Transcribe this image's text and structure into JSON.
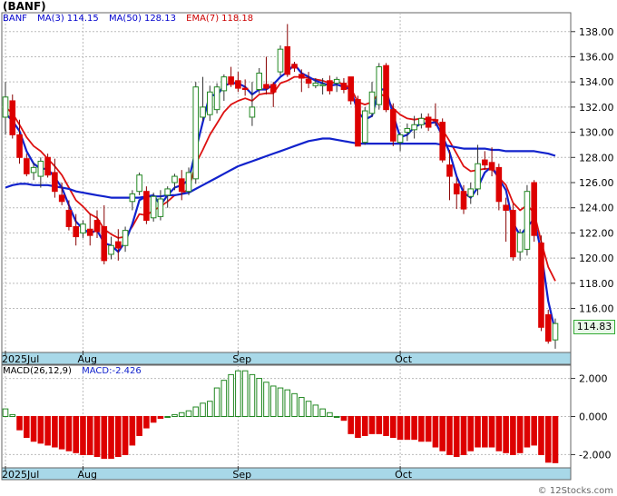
{
  "header": {
    "title": "(BANF)",
    "legend": {
      "symbol": "BANF",
      "ma3": "MA(3)",
      "ma3_value": "114.15",
      "ma50": "MA(50)",
      "ma50_value": "128.13",
      "ema7": "EMA(7)",
      "ema7_value": "118.18"
    }
  },
  "macd_panel": {
    "label": "MACD(26,12,9)",
    "value_label": "MACD:-2.426"
  },
  "last_price_label": "114.83",
  "watermark": "© 12Stocks.com",
  "colors": {
    "up": "#228822",
    "down": "#dd0000",
    "ma3": "#1122cc",
    "ma50": "#1122cc",
    "ema7": "#dd1111",
    "axis_band": "#a8d8e8"
  },
  "chart_data": [
    {
      "type": "candlestick",
      "x_tick_labels": [
        "2025Jul",
        "Aug",
        "Sep",
        "Oct"
      ],
      "y_tick_labels": [
        "116.00",
        "118.00",
        "120.00",
        "122.00",
        "124.00",
        "126.00",
        "128.00",
        "130.00",
        "132.00",
        "134.00",
        "136.00",
        "138.00"
      ],
      "ylim": [
        112.5,
        139.5
      ],
      "last_price": 114.83,
      "ohlc": [
        {
          "o": 131.2,
          "h": 134,
          "l": 129.8,
          "c": 132.8
        },
        {
          "o": 132.5,
          "h": 133,
          "l": 129.5,
          "c": 129.8
        },
        {
          "o": 129.8,
          "h": 131,
          "l": 127.5,
          "c": 128
        },
        {
          "o": 127.9,
          "h": 128.3,
          "l": 126.5,
          "c": 126.7
        },
        {
          "o": 126.8,
          "h": 127.6,
          "l": 126.2,
          "c": 127.2
        },
        {
          "o": 126.5,
          "h": 128,
          "l": 125.6,
          "c": 127.7
        },
        {
          "o": 128,
          "h": 128.3,
          "l": 126.4,
          "c": 126.6
        },
        {
          "o": 126.8,
          "h": 127.9,
          "l": 124.8,
          "c": 125.3
        },
        {
          "o": 125,
          "h": 126,
          "l": 124.2,
          "c": 124.5
        },
        {
          "o": 123.8,
          "h": 124.6,
          "l": 122.2,
          "c": 122.5
        },
        {
          "o": 122.5,
          "h": 123.5,
          "l": 121,
          "c": 121.7
        },
        {
          "o": 122,
          "h": 123,
          "l": 121.6,
          "c": 122.7
        },
        {
          "o": 122.3,
          "h": 123.5,
          "l": 121,
          "c": 121.8
        },
        {
          "o": 123,
          "h": 123.8,
          "l": 121.6,
          "c": 122.1
        },
        {
          "o": 122.5,
          "h": 124.2,
          "l": 119.5,
          "c": 119.8
        },
        {
          "o": 120.3,
          "h": 121.7,
          "l": 119.9,
          "c": 121
        },
        {
          "o": 121.3,
          "h": 122.3,
          "l": 119.8,
          "c": 120.8
        },
        {
          "o": 121,
          "h": 122.5,
          "l": 120.5,
          "c": 122.2
        },
        {
          "o": 124.5,
          "h": 125.4,
          "l": 123.8,
          "c": 125.1
        },
        {
          "o": 125.3,
          "h": 126.8,
          "l": 125,
          "c": 126.6
        },
        {
          "o": 125.3,
          "h": 125.7,
          "l": 122.7,
          "c": 123
        },
        {
          "o": 123.2,
          "h": 125.2,
          "l": 122.9,
          "c": 124.9
        },
        {
          "o": 123.3,
          "h": 125.4,
          "l": 123,
          "c": 124.7
        },
        {
          "o": 125,
          "h": 125.7,
          "l": 124,
          "c": 125.5
        },
        {
          "o": 126,
          "h": 126.7,
          "l": 125.4,
          "c": 126.5
        },
        {
          "o": 126.3,
          "h": 127,
          "l": 124.6,
          "c": 125.3
        },
        {
          "o": 125.3,
          "h": 127.2,
          "l": 125,
          "c": 126.8
        },
        {
          "o": 126.3,
          "h": 134,
          "l": 125.9,
          "c": 133.6
        },
        {
          "o": 131.2,
          "h": 134.4,
          "l": 130.9,
          "c": 132
        },
        {
          "o": 131.4,
          "h": 133.7,
          "l": 130.9,
          "c": 133.2
        },
        {
          "o": 131.8,
          "h": 133.9,
          "l": 131.5,
          "c": 133.6
        },
        {
          "o": 133.3,
          "h": 134.6,
          "l": 132.5,
          "c": 134.4
        },
        {
          "o": 134.4,
          "h": 135.2,
          "l": 133.6,
          "c": 133.8
        },
        {
          "o": 134.1,
          "h": 134.8,
          "l": 133.2,
          "c": 133.5
        },
        {
          "o": 133.5,
          "h": 134.2,
          "l": 132.9,
          "c": 133.4
        },
        {
          "o": 131.2,
          "h": 134,
          "l": 130.5,
          "c": 132
        },
        {
          "o": 133.4,
          "h": 135.1,
          "l": 133.1,
          "c": 134.7
        },
        {
          "o": 133.8,
          "h": 136,
          "l": 133,
          "c": 133.5
        },
        {
          "o": 133.8,
          "h": 134,
          "l": 132,
          "c": 133.2
        },
        {
          "o": 134.8,
          "h": 136.9,
          "l": 134.5,
          "c": 136.6
        },
        {
          "o": 136.8,
          "h": 138.6,
          "l": 134.4,
          "c": 134.6
        },
        {
          "o": 135.4,
          "h": 135.6,
          "l": 134.8,
          "c": 135.1
        },
        {
          "o": 134.6,
          "h": 135,
          "l": 133.2,
          "c": 134.3
        },
        {
          "o": 134.2,
          "h": 134.8,
          "l": 133.5,
          "c": 133.9
        },
        {
          "o": 133.7,
          "h": 134.3,
          "l": 133.5,
          "c": 133.9
        },
        {
          "o": 133.7,
          "h": 134.3,
          "l": 133,
          "c": 133.8
        },
        {
          "o": 134.1,
          "h": 134.5,
          "l": 133,
          "c": 133.3
        },
        {
          "o": 133.9,
          "h": 134.4,
          "l": 133.2,
          "c": 134.2
        },
        {
          "o": 133.9,
          "h": 134.3,
          "l": 133.1,
          "c": 133.4
        },
        {
          "o": 134.4,
          "h": 134.4,
          "l": 132.2,
          "c": 132.5
        },
        {
          "o": 132.6,
          "h": 132.9,
          "l": 128.9,
          "c": 128.9
        },
        {
          "o": 129.2,
          "h": 132,
          "l": 129,
          "c": 131.7
        },
        {
          "o": 131.5,
          "h": 134,
          "l": 131.2,
          "c": 133.2
        },
        {
          "o": 132.2,
          "h": 135.5,
          "l": 131.8,
          "c": 135.2
        },
        {
          "o": 135.3,
          "h": 135.5,
          "l": 131.6,
          "c": 131.8
        },
        {
          "o": 131.8,
          "h": 132.3,
          "l": 128.9,
          "c": 129.3
        },
        {
          "o": 129.2,
          "h": 130,
          "l": 128.5,
          "c": 129.8
        },
        {
          "o": 130,
          "h": 130.7,
          "l": 129.3,
          "c": 130.3
        },
        {
          "o": 130.2,
          "h": 131.3,
          "l": 129.5,
          "c": 130.6
        },
        {
          "o": 130.6,
          "h": 131.5,
          "l": 130.3,
          "c": 131.1
        },
        {
          "o": 131.2,
          "h": 131.5,
          "l": 130.1,
          "c": 130.4
        },
        {
          "o": 131,
          "h": 132.3,
          "l": 130.5,
          "c": 130.9
        },
        {
          "o": 130.8,
          "h": 131.1,
          "l": 127.6,
          "c": 127.8
        },
        {
          "o": 127.4,
          "h": 128.6,
          "l": 124.6,
          "c": 126.5
        },
        {
          "o": 125.9,
          "h": 126.4,
          "l": 123.9,
          "c": 125.1
        },
        {
          "o": 125.3,
          "h": 125.8,
          "l": 123.5,
          "c": 123.9
        },
        {
          "o": 124.9,
          "h": 126,
          "l": 124.3,
          "c": 125.5
        },
        {
          "o": 125.5,
          "h": 129,
          "l": 125,
          "c": 127.5
        },
        {
          "o": 127.8,
          "h": 128.5,
          "l": 127,
          "c": 127.4
        },
        {
          "o": 127.6,
          "h": 128.8,
          "l": 126.5,
          "c": 127
        },
        {
          "o": 127.2,
          "h": 127.5,
          "l": 123.8,
          "c": 124.5
        },
        {
          "o": 124.2,
          "h": 124.8,
          "l": 121.3,
          "c": 123.8
        },
        {
          "o": 123.8,
          "h": 124.3,
          "l": 119.8,
          "c": 120.1
        },
        {
          "o": 120.5,
          "h": 122.3,
          "l": 119.8,
          "c": 122
        },
        {
          "o": 120.7,
          "h": 125.8,
          "l": 120.2,
          "c": 125.3
        },
        {
          "o": 126,
          "h": 126.2,
          "l": 121.3,
          "c": 121.8
        },
        {
          "o": 121.2,
          "h": 121.8,
          "l": 114.2,
          "c": 114.5
        },
        {
          "o": 115.5,
          "h": 115.9,
          "l": 113.2,
          "c": 113.4
        },
        {
          "o": 113.5,
          "h": 115.2,
          "l": 112.8,
          "c": 114.8
        }
      ],
      "ma3": [
        131.5,
        130.9,
        130.1,
        128.5,
        127.5,
        127.1,
        127.1,
        126.4,
        125.6,
        124.2,
        122.9,
        122.3,
        122,
        122.2,
        121.2,
        121,
        120.5,
        121.3,
        122.7,
        124.6,
        124.9,
        125,
        124.2,
        125,
        125.6,
        125.8,
        126.2,
        128.6,
        130.8,
        133,
        132.9,
        133.7,
        133.9,
        133.9,
        133.6,
        133,
        133.4,
        133.4,
        133.8,
        134.4,
        134.8,
        135.4,
        134.7,
        134.4,
        134.1,
        133.9,
        133.7,
        133.8,
        133.6,
        133.4,
        131.6,
        131,
        131.3,
        133.4,
        133.4,
        131.4,
        129.6,
        129.8,
        130.4,
        130.7,
        130.7,
        130.8,
        129.7,
        128.4,
        126.5,
        125.2,
        124.8,
        125.6,
        126.8,
        127.3,
        126.3,
        125.4,
        122.8,
        121.8,
        122.5,
        123.1,
        120.5,
        116.6,
        114.15
      ],
      "ma50": [
        125.6,
        125.8,
        125.9,
        125.9,
        125.8,
        125.8,
        125.8,
        125.7,
        125.6,
        125.5,
        125.3,
        125.2,
        125.1,
        125,
        124.9,
        124.8,
        124.8,
        124.8,
        124.8,
        124.8,
        124.9,
        124.9,
        124.9,
        125,
        125,
        125.1,
        125.2,
        125.5,
        125.8,
        126.1,
        126.4,
        126.7,
        127,
        127.3,
        127.5,
        127.7,
        127.9,
        128.1,
        128.3,
        128.5,
        128.7,
        128.9,
        129.1,
        129.3,
        129.4,
        129.5,
        129.5,
        129.4,
        129.3,
        129.2,
        129.1,
        129.1,
        129.1,
        129.1,
        129.1,
        129.1,
        129.1,
        129.1,
        129.1,
        129.1,
        129.1,
        129.1,
        129,
        128.9,
        128.8,
        128.7,
        128.7,
        128.7,
        128.7,
        128.6,
        128.6,
        128.5,
        128.5,
        128.5,
        128.5,
        128.5,
        128.4,
        128.3,
        128.13
      ],
      "ema7": [
        132,
        131.5,
        130.6,
        129.6,
        128.9,
        128.5,
        127.9,
        127.3,
        126.6,
        125.6,
        124.6,
        124.1,
        123.5,
        123.2,
        122.3,
        121.9,
        121.6,
        121.7,
        122.5,
        123.5,
        123.4,
        123.8,
        124.1,
        124.5,
        125,
        125.1,
        125.5,
        127.5,
        128.6,
        129.8,
        130.7,
        131.6,
        132.2,
        132.5,
        132.7,
        132.5,
        133,
        133.1,
        133.1,
        133.9,
        134.1,
        134.4,
        134.4,
        134.3,
        134.2,
        134.1,
        133.9,
        134,
        133.8,
        133.5,
        132.4,
        132.2,
        132.4,
        133.1,
        132.8,
        131.9,
        131.4,
        131.1,
        131,
        131.1,
        131,
        131,
        130.2,
        129.3,
        128.3,
        127.3,
        126.9,
        127,
        127.1,
        127.1,
        126.4,
        125.8,
        124.4,
        123.8,
        124.2,
        123.6,
        121.3,
        119.3,
        118.18
      ],
      "x_tick_index": [
        0,
        11,
        33,
        56
      ]
    },
    {
      "type": "bar",
      "title": "MACD(26,12,9)",
      "y_tick_labels": [
        "2.000",
        "0.000",
        "-2.000"
      ],
      "ylim": [
        -2.6,
        2.6
      ],
      "values": [
        0.4,
        0.1,
        -0.7,
        -1.1,
        -1.3,
        -1.4,
        -1.5,
        -1.6,
        -1.7,
        -1.8,
        -1.9,
        -2.0,
        -2.0,
        -2.1,
        -2.2,
        -2.2,
        -2.1,
        -2.0,
        -1.5,
        -1.0,
        -0.6,
        -0.3,
        -0.1,
        0.0,
        0.1,
        0.2,
        0.3,
        0.5,
        0.7,
        0.8,
        1.5,
        1.9,
        2.2,
        2.4,
        2.4,
        2.2,
        2.0,
        1.8,
        1.6,
        1.5,
        1.4,
        1.2,
        1.0,
        0.8,
        0.6,
        0.4,
        0.2,
        0.0,
        -0.2,
        -0.9,
        -1.1,
        -1.0,
        -0.9,
        -0.9,
        -1.0,
        -1.1,
        -1.2,
        -1.2,
        -1.2,
        -1.3,
        -1.3,
        -1.6,
        -1.8,
        -2.0,
        -2.1,
        -2.0,
        -1.8,
        -1.6,
        -1.6,
        -1.6,
        -1.8,
        -1.9,
        -2.0,
        -1.9,
        -1.6,
        -1.5,
        -2.0,
        -2.4,
        -2.426
      ]
    }
  ]
}
